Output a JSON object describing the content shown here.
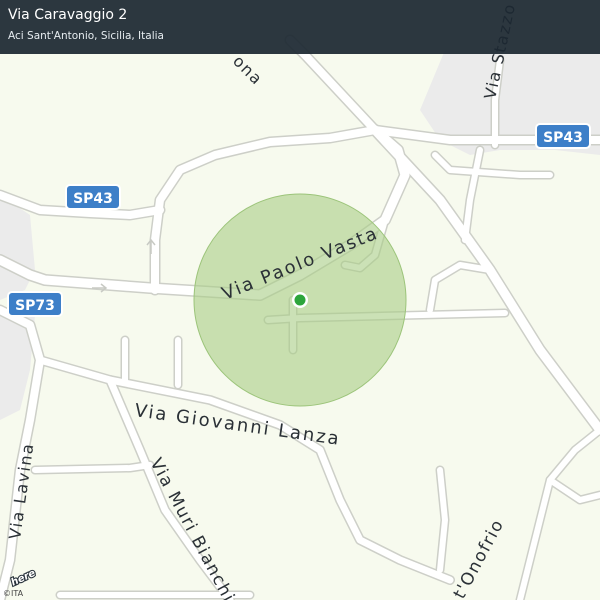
{
  "header": {
    "title": "Via Caravaggio 2",
    "subtitle": "Aci Sant'Antonio, Sicilia, Italia"
  },
  "roads": {
    "shields": [
      "SP43",
      "SP43",
      "SP73"
    ],
    "labels": {
      "via_paolo_vasta": "Via Paolo Vasta",
      "via_giovanni_lanza": "Via Giovanni Lanza",
      "via_muri_bianchi": "Via Muri Bianchi",
      "via_lavina": "Via Lavina",
      "via_stazzo": "Via Stazzo",
      "top_partial": "ona",
      "via_onofrio_partial": "t'Onofrio"
    }
  },
  "logo": "here",
  "copyright": "©ITA",
  "colors": {
    "background": "#f7faee",
    "road": "#ffffff",
    "road_casing": "#cdcfc8",
    "urban": "#ebebeb",
    "accuracy_circle": "#a8cd85",
    "location_dot": "#2da53b",
    "shield": "#3d7fc8",
    "header": "#1c2831"
  }
}
